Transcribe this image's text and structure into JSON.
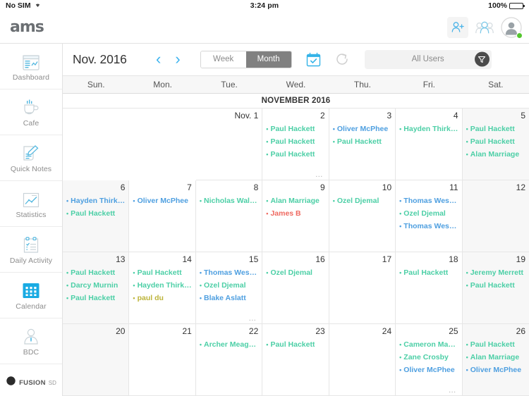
{
  "status_bar": {
    "carrier": "No SIM",
    "wifi_icon": "wifi-icon",
    "time": "3:24 pm",
    "battery_text": "100%"
  },
  "topbar": {
    "logo_text": "ams",
    "actions": [
      {
        "name": "add-user-icon",
        "label": ""
      },
      {
        "name": "users-group-icon",
        "label": ""
      },
      {
        "name": "profile-avatar",
        "label": ""
      }
    ]
  },
  "sidebar": {
    "items": [
      {
        "label": "Dashboard",
        "icon": "dashboard-icon",
        "active": false
      },
      {
        "label": "Cafe",
        "icon": "coffee-cup-icon",
        "active": false
      },
      {
        "label": "Quick Notes",
        "icon": "notes-pencil-icon",
        "active": false
      },
      {
        "label": "Statistics",
        "icon": "line-chart-icon",
        "active": false
      },
      {
        "label": "Daily Activity",
        "icon": "checklist-icon",
        "active": false
      },
      {
        "label": "Calendar",
        "icon": "calendar-grid-icon",
        "active": true
      },
      {
        "label": "BDC",
        "icon": "person-tie-icon",
        "active": false
      }
    ],
    "footer": {
      "brand": "FUSION",
      "brand_suffix": "SD",
      "icon": "fusion-moon-icon"
    }
  },
  "toolbar": {
    "title": "Nov. 2016",
    "prev_label": "‹",
    "next_label": "›",
    "segments": [
      {
        "label": "Week",
        "active": false
      },
      {
        "label": "Month",
        "active": true
      }
    ],
    "today_icon": "calendar-check-icon",
    "refresh_icon": "refresh-icon",
    "users_filter_label": "All Users",
    "filter_icon": "funnel-icon"
  },
  "calendar": {
    "weekdays": [
      "Sun.",
      "Mon.",
      "Tue.",
      "Wed.",
      "Thu.",
      "Fri.",
      "Sat."
    ],
    "month_banner": "NOVEMBER 2016",
    "colors": {
      "green": "#4ccfa6",
      "blue": "#4e9fe0",
      "red": "#ef6a61",
      "olive": "#bdb43a"
    },
    "cells": [
      {
        "day": "",
        "blank": true,
        "weekend": true,
        "events": [],
        "more": false
      },
      {
        "day": "",
        "blank": true,
        "weekend": false,
        "events": [],
        "more": false
      },
      {
        "day": "Nov. 1",
        "blank": false,
        "weekend": false,
        "events": [],
        "more": false
      },
      {
        "day": "2",
        "blank": false,
        "weekend": false,
        "more": true,
        "events": [
          {
            "name": "Paul Hackett",
            "color": "green"
          },
          {
            "name": "Paul Hackett",
            "color": "green"
          },
          {
            "name": "Paul Hackett",
            "color": "green"
          }
        ]
      },
      {
        "day": "3",
        "blank": false,
        "weekend": false,
        "more": false,
        "events": [
          {
            "name": "Oliver McPhee",
            "color": "blue"
          },
          {
            "name": "Paul Hackett",
            "color": "green"
          }
        ]
      },
      {
        "day": "4",
        "blank": false,
        "weekend": false,
        "more": false,
        "events": [
          {
            "name": "Hayden Thirkell",
            "color": "green"
          }
        ]
      },
      {
        "day": "5",
        "blank": false,
        "weekend": true,
        "more": false,
        "events": [
          {
            "name": "Paul Hackett",
            "color": "green"
          },
          {
            "name": "Paul Hackett",
            "color": "green"
          },
          {
            "name": "Alan Marriage",
            "color": "green"
          }
        ]
      },
      {
        "day": "6",
        "blank": false,
        "weekend": true,
        "more": false,
        "events": [
          {
            "name": "Hayden Thirkell",
            "color": "blue"
          },
          {
            "name": "Paul Hackett",
            "color": "green"
          }
        ]
      },
      {
        "day": "7",
        "blank": false,
        "weekend": false,
        "more": false,
        "events": [
          {
            "name": "Oliver McPhee",
            "color": "blue"
          }
        ]
      },
      {
        "day": "8",
        "blank": false,
        "weekend": false,
        "more": false,
        "events": [
          {
            "name": "Nicholas Walcott",
            "color": "green"
          }
        ]
      },
      {
        "day": "9",
        "blank": false,
        "weekend": false,
        "more": false,
        "events": [
          {
            "name": "Alan Marriage",
            "color": "green"
          },
          {
            "name": "James B",
            "color": "red"
          }
        ]
      },
      {
        "day": "10",
        "blank": false,
        "weekend": false,
        "more": false,
        "events": [
          {
            "name": "Ozel Djemal",
            "color": "green"
          }
        ]
      },
      {
        "day": "11",
        "blank": false,
        "weekend": false,
        "more": false,
        "events": [
          {
            "name": "Thomas Westgar...",
            "color": "blue"
          },
          {
            "name": "Ozel Djemal",
            "color": "green"
          },
          {
            "name": "Thomas Westgar...",
            "color": "blue"
          }
        ]
      },
      {
        "day": "12",
        "blank": false,
        "weekend": true,
        "more": false,
        "events": []
      },
      {
        "day": "13",
        "blank": false,
        "weekend": true,
        "more": false,
        "events": [
          {
            "name": "Paul Hackett",
            "color": "green"
          },
          {
            "name": "Darcy Murnin",
            "color": "green"
          },
          {
            "name": "Paul Hackett",
            "color": "green"
          }
        ]
      },
      {
        "day": "14",
        "blank": false,
        "weekend": false,
        "more": false,
        "events": [
          {
            "name": "Paul Hackett",
            "color": "green"
          },
          {
            "name": "Hayden Thirkell",
            "color": "green"
          },
          {
            "name": "paul du",
            "color": "olive"
          }
        ]
      },
      {
        "day": "15",
        "blank": false,
        "weekend": false,
        "more": true,
        "events": [
          {
            "name": "Thomas Westgar...",
            "color": "blue"
          },
          {
            "name": "Ozel Djemal",
            "color": "green"
          },
          {
            "name": "Blake Aslatt",
            "color": "blue"
          }
        ]
      },
      {
        "day": "16",
        "blank": false,
        "weekend": false,
        "more": false,
        "events": [
          {
            "name": "Ozel Djemal",
            "color": "green"
          }
        ]
      },
      {
        "day": "17",
        "blank": false,
        "weekend": false,
        "more": false,
        "events": []
      },
      {
        "day": "18",
        "blank": false,
        "weekend": false,
        "more": false,
        "events": [
          {
            "name": "Paul Hackett",
            "color": "green"
          }
        ]
      },
      {
        "day": "19",
        "blank": false,
        "weekend": true,
        "more": false,
        "events": [
          {
            "name": "Jeremy Merrett",
            "color": "green"
          },
          {
            "name": "Paul Hackett",
            "color": "green"
          }
        ]
      },
      {
        "day": "20",
        "blank": false,
        "weekend": true,
        "more": false,
        "events": []
      },
      {
        "day": "21",
        "blank": false,
        "weekend": false,
        "more": false,
        "events": []
      },
      {
        "day": "22",
        "blank": false,
        "weekend": false,
        "more": false,
        "events": [
          {
            "name": "Archer Meagher",
            "color": "green"
          }
        ]
      },
      {
        "day": "23",
        "blank": false,
        "weekend": false,
        "more": false,
        "events": [
          {
            "name": "Paul Hackett",
            "color": "green"
          }
        ]
      },
      {
        "day": "24",
        "blank": false,
        "weekend": false,
        "more": false,
        "events": []
      },
      {
        "day": "25",
        "blank": false,
        "weekend": false,
        "more": true,
        "events": [
          {
            "name": "Cameron Macke...",
            "color": "green"
          },
          {
            "name": "Zane Crosby",
            "color": "green"
          },
          {
            "name": "Oliver McPhee",
            "color": "blue"
          }
        ]
      },
      {
        "day": "26",
        "blank": false,
        "weekend": true,
        "more": false,
        "events": [
          {
            "name": "Paul Hackett",
            "color": "green"
          },
          {
            "name": "Alan Marriage",
            "color": "green"
          },
          {
            "name": "Oliver McPhee",
            "color": "blue"
          }
        ]
      }
    ]
  }
}
